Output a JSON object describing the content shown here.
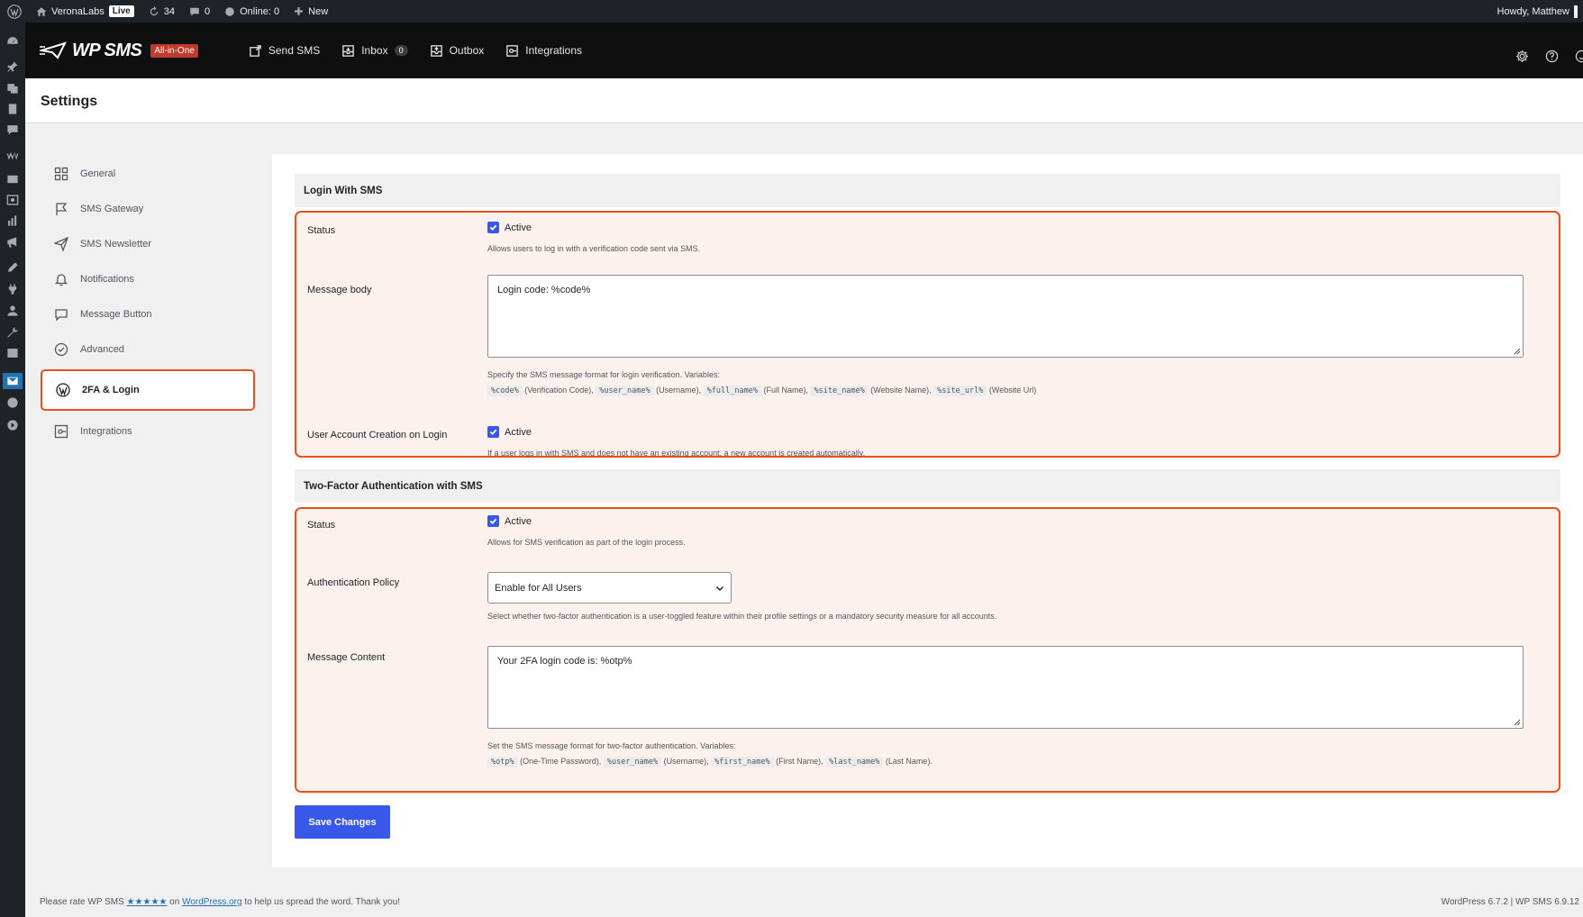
{
  "admin_bar": {
    "site_name": "VeronaLabs",
    "live_badge": "Live",
    "updates_count": "34",
    "comments_count": "0",
    "online_label": "Online: 0",
    "new_label": "New",
    "howdy": "Howdy, Matthew"
  },
  "plugin_header": {
    "logo_text": "WP SMS",
    "logo_badge": "All-in-One",
    "nav": {
      "send_sms": "Send SMS",
      "inbox": "Inbox",
      "inbox_count": "0",
      "outbox": "Outbox",
      "integrations": "Integrations"
    }
  },
  "page": {
    "title": "Settings"
  },
  "settings_nav": {
    "general": "General",
    "sms_gateway": "SMS Gateway",
    "sms_newsletter": "SMS Newsletter",
    "notifications": "Notifications",
    "message_button": "Message Button",
    "advanced": "Advanced",
    "twofa_login": "2FA & Login",
    "integrations": "Integrations"
  },
  "login_with_sms": {
    "heading": "Login With SMS",
    "status_label": "Status",
    "status_check": "Active",
    "status_desc": "Allows users to log in with a verification code sent via SMS.",
    "message_body_label": "Message body",
    "message_body_value": "Login code: %code%",
    "message_body_desc": "Specify the SMS message format for login verification. Variables:",
    "vars": {
      "code": "%code%",
      "code_desc": "(Verification Code),",
      "user_name": "%user_name%",
      "user_name_desc": "(Username),",
      "full_name": "%full_name%",
      "full_name_desc": "(Full Name),",
      "site_name": "%site_name%",
      "site_name_desc": "(Website Name),",
      "site_url": "%site_url%",
      "site_url_desc": "(Website Url)"
    },
    "account_creation_label": "User Account Creation on Login",
    "account_creation_check": "Active",
    "account_creation_desc": "If a user logs in with SMS and does not have an existing account, a new account is created automatically."
  },
  "two_factor": {
    "heading": "Two-Factor Authentication with SMS",
    "status_label": "Status",
    "status_check": "Active",
    "status_desc": "Allows for SMS verification as part of the login process.",
    "policy_label": "Authentication Policy",
    "policy_value": "Enable for All Users",
    "policy_desc": "Select whether two-factor authentication is a user-toggled feature within their profile settings or a mandatory security measure for all accounts.",
    "message_content_label": "Message Content",
    "message_content_value": "Your 2FA login code is: %otp%",
    "message_content_desc": "Set the SMS message format for two-factor authentication. Variables:",
    "vars": {
      "otp": "%otp%",
      "otp_desc": "(One-Time Password),",
      "user_name": "%user_name%",
      "user_name_desc": "(Username),",
      "first_name": "%first_name%",
      "first_name_desc": "(First Name),",
      "last_name": "%last_name%",
      "last_name_desc": "(Last Name)."
    }
  },
  "save_button": "Save Changes",
  "footer": {
    "rate_prefix": "Please rate",
    "rate_plugin": "WP SMS",
    "stars": "★★★★★",
    "on": "on",
    "wp_link": "WordPress.org",
    "rate_suffix": "to help us spread the word. Thank you!",
    "version": "WordPress 6.7.2 | WP SMS 6.9.12"
  },
  "colors": {
    "accent_orange": "#e8501e",
    "primary_blue": "#3858e9",
    "admin_dark": "#1d2327",
    "highlight_bg": "#fcf1ec"
  }
}
